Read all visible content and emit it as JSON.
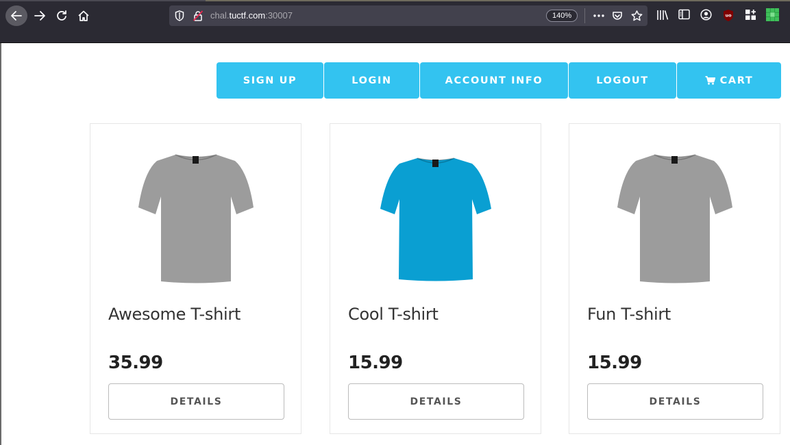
{
  "browser": {
    "url_prefix": "chal.",
    "url_host": "tuctf.com",
    "url_suffix": ":30007",
    "zoom": "140%",
    "extension_badge": "uo"
  },
  "site_nav": {
    "items": [
      {
        "label": "SIGN UP"
      },
      {
        "label": "LOGIN"
      },
      {
        "label": "ACCOUNT INFO"
      },
      {
        "label": "LOGOUT"
      },
      {
        "label": "CART",
        "icon": "shopping-cart-icon"
      }
    ],
    "color": "#33c3f0"
  },
  "products": [
    {
      "name": "Awesome T-shirt",
      "price": "35.99",
      "details_label": "DETAILS",
      "shirt_color": "#9c9c9c"
    },
    {
      "name": "Cool T-shirt",
      "price": "15.99",
      "details_label": "DETAILS",
      "shirt_color": "#0a9fd2"
    },
    {
      "name": "Fun T-shirt",
      "price": "15.99",
      "details_label": "DETAILS",
      "shirt_color": "#9c9c9c"
    }
  ]
}
